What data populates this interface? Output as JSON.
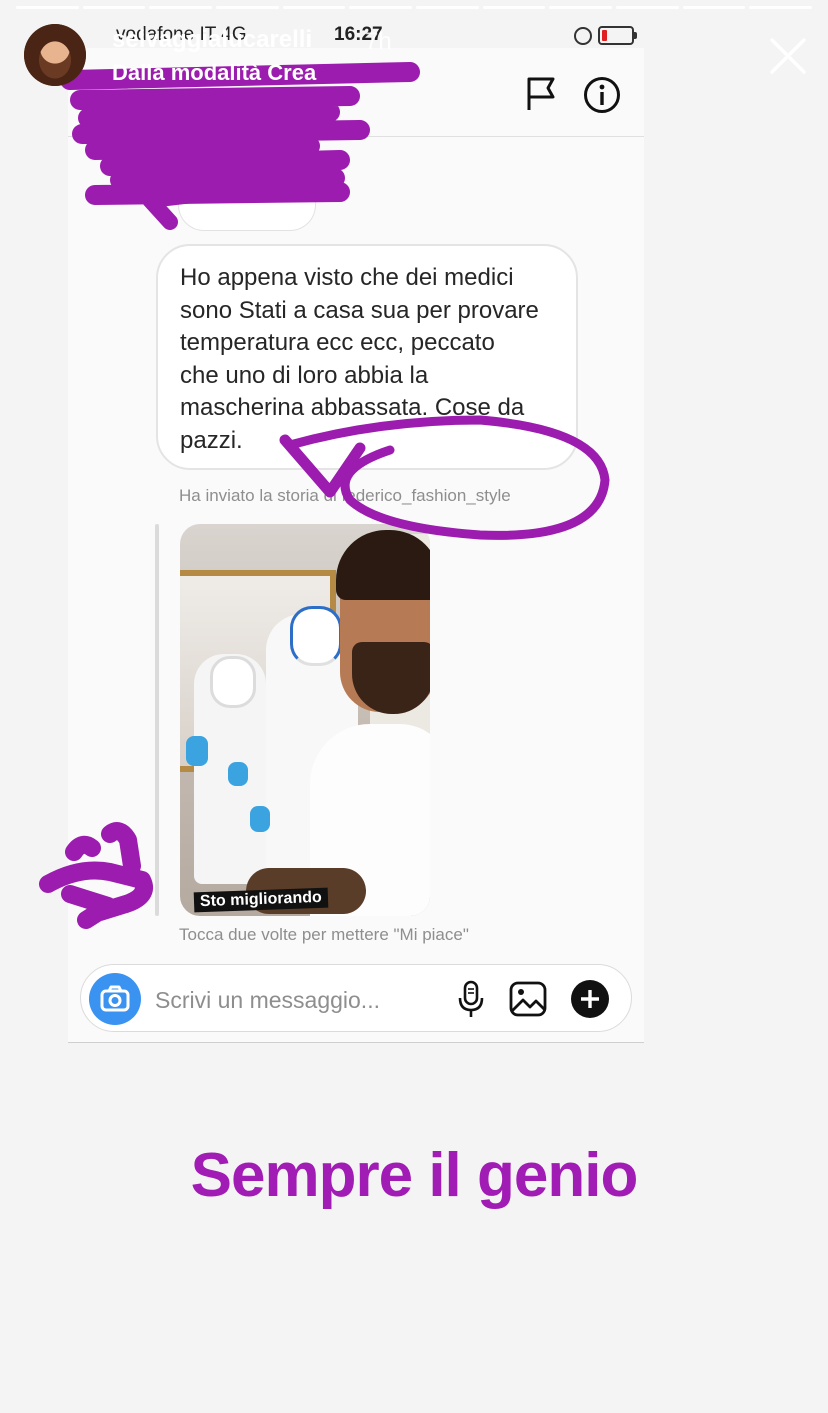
{
  "story": {
    "username": "selvaggialucarelli",
    "time_ago": "7h",
    "subtitle": "Dalla modalità Crea",
    "progress_segments": 12,
    "caption": "Sempre il genio",
    "caption_color": "#a11bb5",
    "scribble_color": "#9b1cae"
  },
  "status_bar": {
    "carrier": "vodafone IT  4G",
    "time": "16:27"
  },
  "dm": {
    "message": "Ho appena visto che dei medici sono Stati a casa sua per provare temperatura ecc ecc, peccato che uno di loro abbia la mascherina abbassata. Cose da pazzi.",
    "message_lines": [
      "Ho appena visto che dei medici",
      "sono Stati a casa sua per provare",
      "temperatura ecc ecc, peccato",
      "che uno di loro abbia la",
      "mascherina abbassata. Cose da",
      "pazzi."
    ],
    "story_note": "Ha inviato la storia di federico_fashion_style",
    "story_preview_caption": "Sto migliorando",
    "like_hint": "Tocca due volte per mettere \"Mi piace\"",
    "composer_placeholder": "Scrivi un messaggio...",
    "accent": "#3a93f0"
  },
  "icons": {
    "close": "close-icon",
    "flag": "flag-icon",
    "info": "info-icon",
    "camera": "camera-icon",
    "mic": "microphone-icon",
    "image": "image-icon",
    "plus": "plus-icon"
  }
}
